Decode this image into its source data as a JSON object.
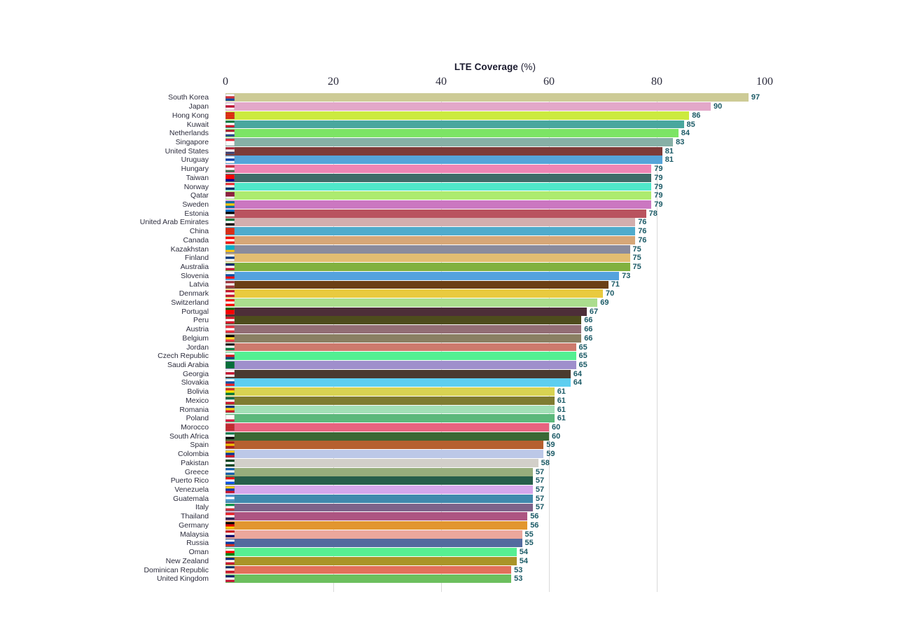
{
  "chart": {
    "title_main": "LTE Coverage",
    "title_unit": "(%)",
    "value_label_color": "#1b5a66",
    "axis_label_color": "#2b2b3c",
    "grid_color": "#d9d9d9",
    "background": "#ffffff"
  },
  "chart_data": {
    "type": "bar",
    "orientation": "horizontal",
    "title": "LTE Coverage (%)",
    "xlabel": "",
    "ylabel": "",
    "xlim": [
      0,
      100
    ],
    "xticks": [
      0,
      20,
      40,
      60,
      80,
      100
    ],
    "grid": true,
    "legend": false,
    "categories": [
      "South Korea",
      "Japan",
      "Hong Kong",
      "Kuwait",
      "Netherlands",
      "Singapore",
      "United States",
      "Uruguay",
      "Hungary",
      "Taiwan",
      "Norway",
      "Qatar",
      "Sweden",
      "Estonia",
      "United Arab Emirates",
      "China",
      "Canada",
      "Kazakhstan",
      "Finland",
      "Australia",
      "Slovenia",
      "Latvia",
      "Denmark",
      "Switzerland",
      "Portugal",
      "Peru",
      "Austria",
      "Belgium",
      "Jordan",
      "Czech Republic",
      "Saudi Arabia",
      "Georgia",
      "Slovakia",
      "Bolivia",
      "Mexico",
      "Romania",
      "Poland",
      "Morocco",
      "South Africa",
      "Spain",
      "Colombia",
      "Pakistan",
      "Greece",
      "Puerto Rico",
      "Venezuela",
      "Guatemala",
      "Italy",
      "Thailand",
      "Germany",
      "Malaysia",
      "Russia",
      "Oman",
      "New Zealand",
      "Dominican Republic",
      "United Kingdom"
    ],
    "values": [
      97,
      90,
      86,
      85,
      84,
      83,
      81,
      81,
      79,
      79,
      79,
      79,
      79,
      78,
      76,
      76,
      76,
      75,
      75,
      75,
      73,
      71,
      70,
      69,
      67,
      66,
      66,
      66,
      65,
      65,
      65,
      64,
      64,
      61,
      61,
      61,
      61,
      60,
      60,
      59,
      59,
      58,
      57,
      57,
      57,
      57,
      57,
      56,
      56,
      55,
      55,
      54,
      54,
      53,
      53
    ],
    "colors": [
      "#cdcb96",
      "#e3a8c9",
      "#ccea3f",
      "#49a79e",
      "#7ce465",
      "#87b0a6",
      "#7d3b38",
      "#55a4d9",
      "#ef85b4",
      "#3f6b68",
      "#4fe8ca",
      "#adeb6f",
      "#cb77c1",
      "#b9535f",
      "#d2aeae",
      "#4fabcc",
      "#d6a778",
      "#8a8b9c",
      "#e2bd72",
      "#81b13f",
      "#54a2de",
      "#6b3f15",
      "#e9ca3f",
      "#abdd8e",
      "#4d2e38",
      "#4e4c1d",
      "#936e75",
      "#8a7f63",
      "#cd7a6d",
      "#53ef92",
      "#9f8fcc",
      "#4a3a30",
      "#5dcef0",
      "#d8d352",
      "#7f7c31",
      "#a2dfb6",
      "#5cb87b",
      "#e8637f",
      "#3b6835",
      "#b6602f",
      "#bcc8e7",
      "#d2cfc9",
      "#97ad7c",
      "#275e4b",
      "#d6a7ec",
      "#4189ad",
      "#7d6289",
      "#ad5582",
      "#e2962f",
      "#eba79c",
      "#536b9e",
      "#57ef92",
      "#a99428",
      "#e2705a",
      "#6cbf5e"
    ],
    "flag_emojis": [
      "🇰🇷",
      "🇯🇵",
      "🇭🇰",
      "🇰🇼",
      "🇳🇱",
      "🇸🇬",
      "🇺🇸",
      "🇺🇾",
      "🇭🇺",
      "🇹🇼",
      "🇳🇴",
      "🇶🇦",
      "🇸🇪",
      "🇪🇪",
      "🇦🇪",
      "🇨🇳",
      "🇨🇦",
      "🇰🇿",
      "🇫🇮",
      "🇦🇺",
      "🇸🇮",
      "🇱🇻",
      "🇩🇰",
      "🇨🇭",
      "🇵🇹",
      "🇵🇪",
      "🇦🇹",
      "🇧🇪",
      "🇯🇴",
      "🇨🇿",
      "🇸🇦",
      "🇬🇪",
      "🇸🇰",
      "🇧🇴",
      "🇲🇽",
      "🇷🇴",
      "🇵🇱",
      "🇲🇦",
      "🇿🇦",
      "🇪🇸",
      "🇨🇴",
      "🇵🇰",
      "🇬🇷",
      "🇵🇷",
      "🇻🇪",
      "🇬🇹",
      "🇮🇹",
      "🇹🇭",
      "🇩🇪",
      "🇲🇾",
      "🇷🇺",
      "🇴🇲",
      "🇳🇿",
      "🇩🇴",
      "🇬🇧"
    ],
    "flag_stripes": [
      [
        "#ffffff",
        "#cd2e3a",
        "#0047a0"
      ],
      [
        "#ffffff",
        "#bc002d",
        "#ffffff"
      ],
      [
        "#de2910",
        "#de2910",
        "#de2910"
      ],
      [
        "#007a3d",
        "#ffffff",
        "#ce1126"
      ],
      [
        "#ae1c28",
        "#ffffff",
        "#21468b"
      ],
      [
        "#ed2939",
        "#ffffff",
        "#ffffff"
      ],
      [
        "#b22234",
        "#ffffff",
        "#3c3b6e"
      ],
      [
        "#ffffff",
        "#0038a8",
        "#ffffff"
      ],
      [
        "#cd2a3e",
        "#ffffff",
        "#436f4d"
      ],
      [
        "#fe0000",
        "#fe0000",
        "#000095"
      ],
      [
        "#ef2b2d",
        "#ffffff",
        "#002868"
      ],
      [
        "#8d1b3d",
        "#8d1b3d",
        "#ffffff"
      ],
      [
        "#006aa7",
        "#fecc00",
        "#006aa7"
      ],
      [
        "#0072ce",
        "#000000",
        "#ffffff"
      ],
      [
        "#00732f",
        "#ffffff",
        "#000000"
      ],
      [
        "#de2910",
        "#de2910",
        "#de2910"
      ],
      [
        "#ff0000",
        "#ffffff",
        "#ff0000"
      ],
      [
        "#00afca",
        "#00afca",
        "#fec50c"
      ],
      [
        "#ffffff",
        "#003580",
        "#ffffff"
      ],
      [
        "#012169",
        "#ffffff",
        "#c8102e"
      ],
      [
        "#ffffff",
        "#0b4ea2",
        "#ff0000"
      ],
      [
        "#9e3039",
        "#ffffff",
        "#9e3039"
      ],
      [
        "#c8102e",
        "#ffffff",
        "#c8102e"
      ],
      [
        "#ff0000",
        "#ffffff",
        "#ff0000"
      ],
      [
        "#006600",
        "#ff0000",
        "#ff0000"
      ],
      [
        "#d91023",
        "#ffffff",
        "#d91023"
      ],
      [
        "#ed2939",
        "#ffffff",
        "#ed2939"
      ],
      [
        "#000000",
        "#fdda24",
        "#ef3340"
      ],
      [
        "#000000",
        "#ffffff",
        "#007a3d"
      ],
      [
        "#ffffff",
        "#d7141a",
        "#11457e"
      ],
      [
        "#006c35",
        "#006c35",
        "#006c35"
      ],
      [
        "#ffffff",
        "#c8102e",
        "#ffffff"
      ],
      [
        "#ffffff",
        "#0b4ea2",
        "#ee1c25"
      ],
      [
        "#d52b1e",
        "#f9e300",
        "#007934"
      ],
      [
        "#006847",
        "#ffffff",
        "#ce1126"
      ],
      [
        "#002b7f",
        "#fcd116",
        "#ce1126"
      ],
      [
        "#ffffff",
        "#ffffff",
        "#dc143c"
      ],
      [
        "#c1272d",
        "#c1272d",
        "#c1272d"
      ],
      [
        "#007a4d",
        "#ffffff",
        "#000000"
      ],
      [
        "#aa151b",
        "#f1bf00",
        "#aa151b"
      ],
      [
        "#fcd116",
        "#003893",
        "#ce1126"
      ],
      [
        "#01411c",
        "#ffffff",
        "#01411c"
      ],
      [
        "#0d5eaf",
        "#ffffff",
        "#0d5eaf"
      ],
      [
        "#ed0000",
        "#ffffff",
        "#0050f0"
      ],
      [
        "#fccf00",
        "#0033ab",
        "#ce1126"
      ],
      [
        "#4997d0",
        "#ffffff",
        "#4997d0"
      ],
      [
        "#009246",
        "#ffffff",
        "#ce2b37"
      ],
      [
        "#ed1c24",
        "#ffffff",
        "#241d4f"
      ],
      [
        "#000000",
        "#dd0000",
        "#ffce00"
      ],
      [
        "#cc0001",
        "#ffffff",
        "#010066"
      ],
      [
        "#ffffff",
        "#0039a6",
        "#d52b1e"
      ],
      [
        "#ffffff",
        "#ff0000",
        "#008000"
      ],
      [
        "#00247d",
        "#ffffff",
        "#cc142b"
      ],
      [
        "#002d62",
        "#ffffff",
        "#ce1126"
      ],
      [
        "#012169",
        "#ffffff",
        "#c8102e"
      ]
    ]
  },
  "axis": {
    "ticks": [
      "0",
      "20",
      "40",
      "60",
      "80",
      "100"
    ]
  }
}
